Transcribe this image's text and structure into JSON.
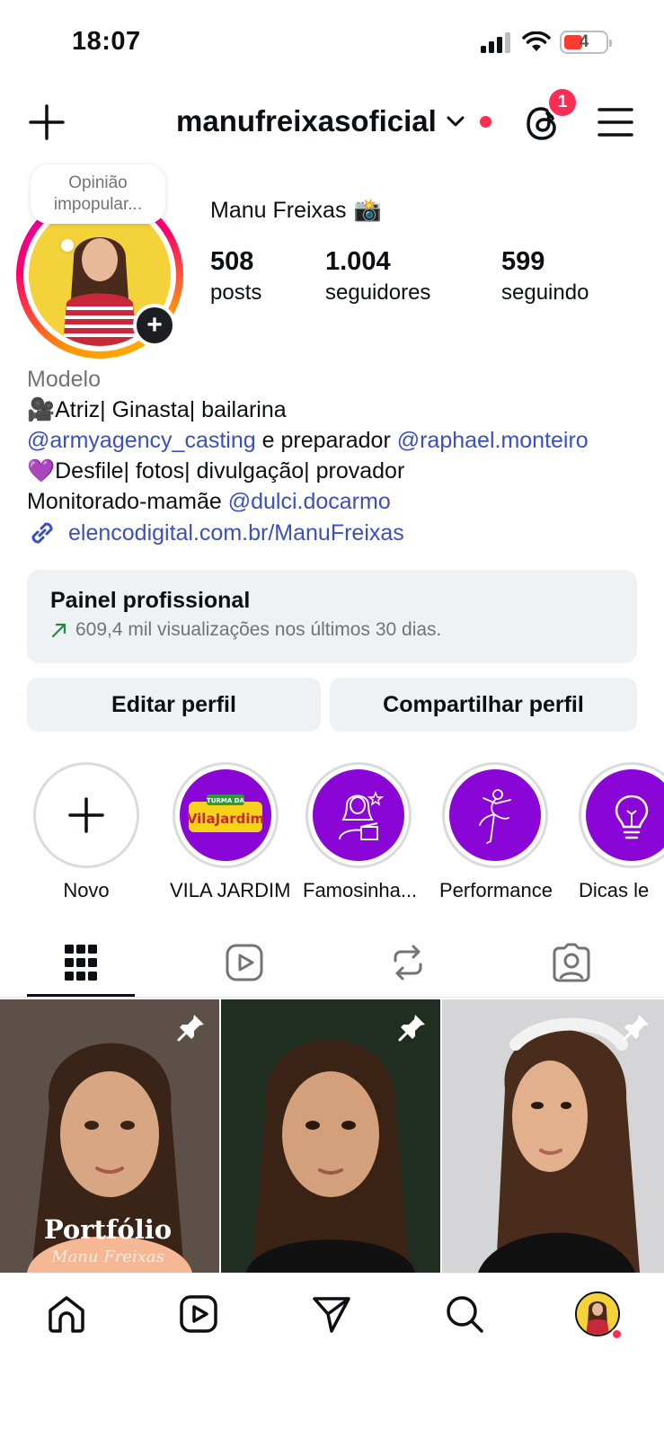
{
  "status_bar": {
    "time": "18:07",
    "battery": "4"
  },
  "header": {
    "username": "manufreixasoficial",
    "threads_badge": "1"
  },
  "profile": {
    "note": "Opinião impopular...",
    "full_name": "Manu Freixas",
    "full_name_emoji": "📸",
    "stats": [
      {
        "value": "508",
        "label": "posts"
      },
      {
        "value": "1.004",
        "label": "seguidores"
      },
      {
        "value": "599",
        "label": "seguindo"
      }
    ]
  },
  "bio": {
    "category": "Modelo",
    "line1": "🎥Atriz| Ginasta| bailarina",
    "line2_mention1": "@armyagency_casting",
    "line2_mid": " e preparador ",
    "line2_mention2": "@raphael.monteiro",
    "line3": "💜Desfile| fotos| divulgação| provador",
    "line4_text": "Monitorado-mamãe ",
    "line4_mention": "@dulci.docarmo",
    "link": "elencodigital.com.br/ManuFreixas"
  },
  "pro_panel": {
    "title": "Painel profissional",
    "subtitle": "609,4 mil visualizações nos últimos 30 dias."
  },
  "buttons": {
    "edit": "Editar perfil",
    "share": "Compartilhar perfil"
  },
  "highlights": [
    {
      "label": "Novo"
    },
    {
      "label": "VILA JARDIM",
      "logo_top": "TURMA DA",
      "logo_main": "VilaJardim"
    },
    {
      "label": "Famosinha..."
    },
    {
      "label": "Performance"
    },
    {
      "label": "Dicas le"
    }
  ],
  "posts": [
    {
      "overlay_title": "Portfólio",
      "overlay_sub": "Manu Freixas"
    },
    {
      "overlay_title": "",
      "overlay_sub": ""
    },
    {
      "overlay_title": "",
      "overlay_sub": ""
    }
  ],
  "colors": {
    "accent": "#3a4fc7",
    "highlight_purple": "#8a06d6",
    "badge_red": "#ff2d55",
    "panel_bg": "#eff2f5"
  }
}
